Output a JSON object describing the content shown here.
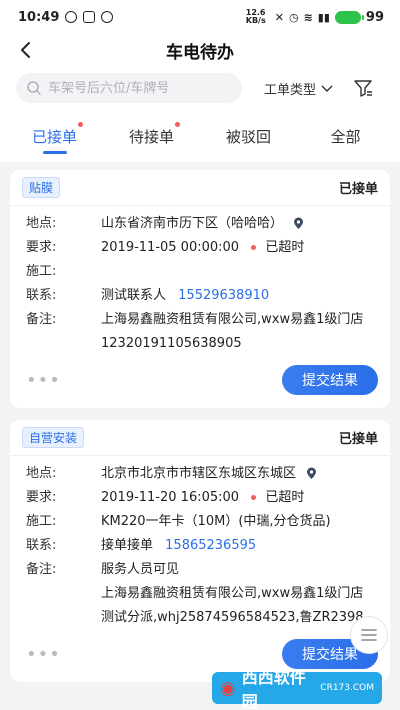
{
  "statusbar": {
    "time": "10:49",
    "net_speed": "12.6 KB/s",
    "battery": "99"
  },
  "nav": {
    "title": "车电待办"
  },
  "search": {
    "placeholder": "车架号后六位/车牌号",
    "type_label": "工单类型"
  },
  "tabs": [
    {
      "label": "已接单",
      "active": true,
      "dot": true
    },
    {
      "label": "待接单",
      "active": false,
      "dot": true
    },
    {
      "label": "被驳回",
      "active": false,
      "dot": false
    },
    {
      "label": "全部",
      "active": false,
      "dot": false
    }
  ],
  "labels": {
    "location": "地点:",
    "required": "要求:",
    "construction": "施工:",
    "contact": "联系:",
    "remark": "备注:"
  },
  "cards": [
    {
      "tag": "贴膜",
      "status": "已接单",
      "location": "山东省济南市历下区（哈哈哈）",
      "required_time": "2019-11-05 00:00:00",
      "overdue": "已超时",
      "construction": "",
      "contact_name": "测试联系人",
      "contact_phone": "15529638910",
      "remark_lines": [
        "上海易鑫融资租赁有限公司,wxw易鑫1级门店",
        "12320191105638905"
      ],
      "more": "•••",
      "button": "提交结果"
    },
    {
      "tag": "自营安装",
      "status": "已接单",
      "location": "北京市北京市市辖区东城区东城区",
      "required_time": "2019-11-20 16:05:00",
      "overdue": "已超时",
      "construction": "KM220一年卡（10M）(中瑞,分仓货品)",
      "contact_name": "接单接单",
      "contact_phone": "15865236595",
      "remark_lines": [
        "服务人员可见",
        "上海易鑫融资租赁有限公司,wxw易鑫1级门店",
        "测试分派,whj25874596584523,鲁ZR2398"
      ],
      "more": "•••",
      "button": "提交结果"
    }
  ],
  "watermark": {
    "brand": "西西软件园",
    "url": "CR173.COM"
  }
}
